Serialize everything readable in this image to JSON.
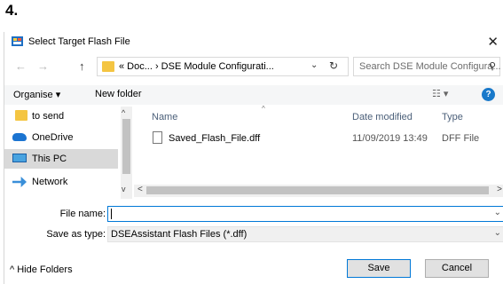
{
  "step_label": "4.",
  "window": {
    "title": "Select Target Flash File",
    "close_glyph": "✕"
  },
  "address": {
    "back_glyph": "←",
    "forward_glyph": "→",
    "up_glyph": "↑",
    "path_text": "« Doc...  ›  DSE Module Configurati...",
    "dropdown_glyph": "⌄",
    "refresh_glyph": "↻"
  },
  "search": {
    "placeholder": "Search DSE Module Configura...",
    "icon_glyph": "⚲"
  },
  "toolbar": {
    "organise": "Organise ▾",
    "new_folder": "New folder",
    "view": "☷ ▾",
    "help": "?"
  },
  "nav": {
    "items": [
      {
        "label": "to send",
        "icon": "folder-icon"
      },
      {
        "label": "OneDrive",
        "icon": "cloud-icon"
      },
      {
        "label": "This PC",
        "icon": "computer-icon"
      },
      {
        "label": "Network",
        "icon": "network-icon"
      }
    ],
    "scroll_up": "^",
    "scroll_down": "v"
  },
  "columns": {
    "name": "Name",
    "date": "Date modified",
    "type": "Type",
    "sort_glyph": "^"
  },
  "files": [
    {
      "name": "Saved_Flash_File.dff",
      "date": "11/09/2019 13:49",
      "type": "DFF File"
    }
  ],
  "hscroll": {
    "left": "<",
    "right": ">"
  },
  "form": {
    "file_name_label": "File name:",
    "file_name_value": "",
    "save_type_label": "Save as type:",
    "save_type_value": "DSEAssistant Flash Files (*.dff)",
    "dropdown_glyph": "⌄"
  },
  "footer": {
    "hide_folders": "^  Hide Folders",
    "save": "Save",
    "cancel": "Cancel"
  },
  "colors": {
    "accent": "#0078d7",
    "selection": "#cce8ff",
    "folder": "#f4c542"
  }
}
